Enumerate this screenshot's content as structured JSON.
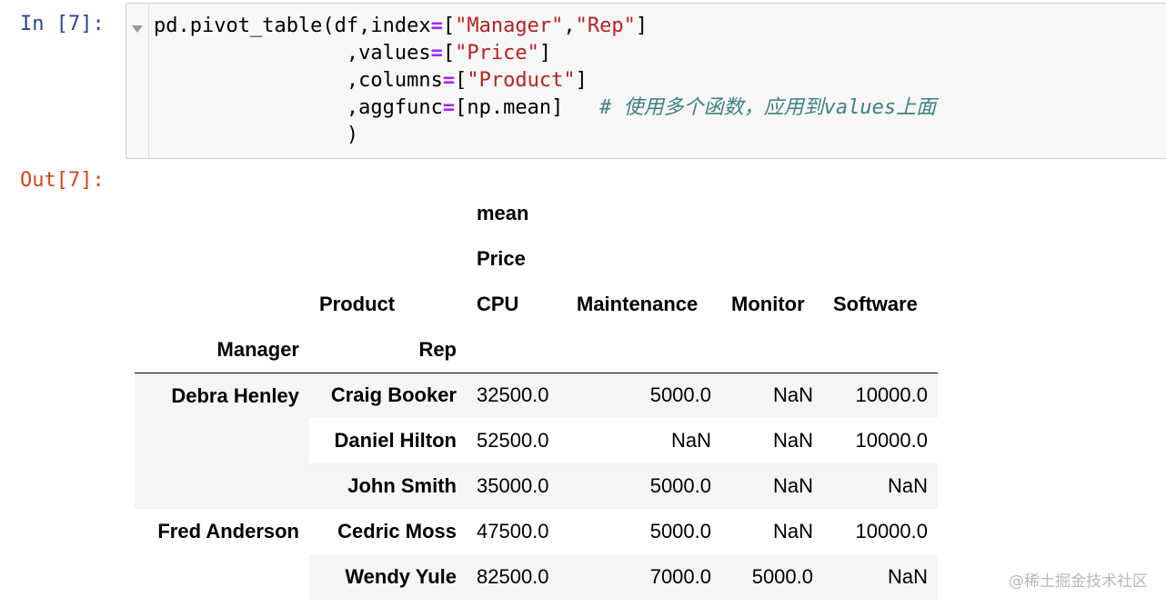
{
  "input_cell": {
    "prompt": "In [7]:",
    "code": {
      "line1": {
        "fn": "pd.pivot_table(df,index",
        "op": "=",
        "open": "[",
        "s1": "\"Manager\"",
        "comma": ",",
        "s2": "\"Rep\"",
        "close": "]"
      },
      "line2": {
        "indent": "                ",
        "key": ",values",
        "op": "=",
        "open": "[",
        "s1": "\"Price\"",
        "close": "]"
      },
      "line3": {
        "indent": "                ",
        "key": ",columns",
        "op": "=",
        "open": "[",
        "s1": "\"Product\"",
        "close": "]"
      },
      "line4": {
        "indent": "                ",
        "key": ",aggfunc",
        "op": "=",
        "val": "[np.mean]",
        "gap": "   ",
        "comment": "# 使用多个函数，应用到values上面"
      },
      "line5": {
        "indent": "                ",
        "close": ")"
      }
    }
  },
  "output_cell": {
    "prompt": "Out[7]:",
    "table": {
      "header_row1": {
        "agg": "mean"
      },
      "header_row2": {
        "values": "Price"
      },
      "header_row3": {
        "product_label": "Product",
        "columns": [
          "CPU",
          "Maintenance",
          "Monitor",
          "Software"
        ]
      },
      "header_row4": {
        "manager_label": "Manager",
        "rep_label": "Rep"
      },
      "rows": [
        {
          "manager": "Debra Henley",
          "rep": "Craig Booker",
          "cpu": "32500.0",
          "maintenance": "5000.0",
          "monitor": "NaN",
          "software": "10000.0"
        },
        {
          "manager": "",
          "rep": "Daniel Hilton",
          "cpu": "52500.0",
          "maintenance": "NaN",
          "monitor": "NaN",
          "software": "10000.0"
        },
        {
          "manager": "",
          "rep": "John Smith",
          "cpu": "35000.0",
          "maintenance": "5000.0",
          "monitor": "NaN",
          "software": "NaN"
        },
        {
          "manager": "Fred Anderson",
          "rep": "Cedric Moss",
          "cpu": "47500.0",
          "maintenance": "5000.0",
          "monitor": "NaN",
          "software": "10000.0"
        },
        {
          "manager": "",
          "rep": "Wendy Yule",
          "cpu": "82500.0",
          "maintenance": "7000.0",
          "monitor": "5000.0",
          "software": "NaN"
        }
      ]
    }
  },
  "watermark": "@稀土掘金技术社区",
  "colors": {
    "in_prompt": "#303f9f",
    "out_prompt": "#d84315",
    "string": "#ba2121",
    "operator": "#aa22ff",
    "comment": "#408080",
    "cell_bg": "#f7f7f7"
  }
}
